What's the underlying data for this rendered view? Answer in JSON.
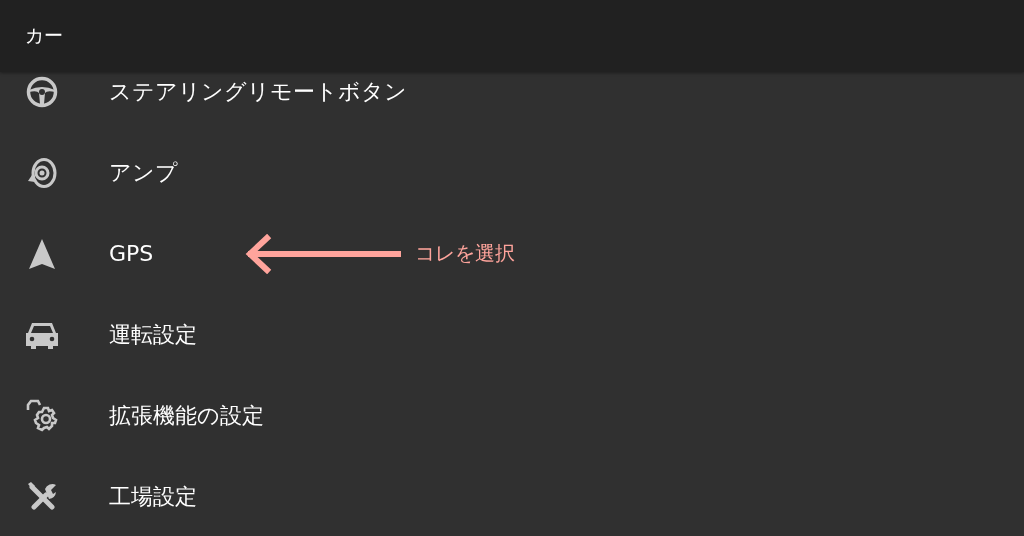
{
  "app_bar": {
    "title": "カー"
  },
  "items": [
    {
      "kind": "steering",
      "label": "ステアリングリモートボタン"
    },
    {
      "kind": "speaker",
      "label": "アンプ"
    },
    {
      "kind": "navigation",
      "label": "GPS",
      "note": "コレを選択"
    },
    {
      "kind": "car",
      "label": "運転設定"
    },
    {
      "kind": "car-gear",
      "label": "拡張機能の設定"
    },
    {
      "kind": "tools",
      "label": "工場設定"
    }
  ]
}
